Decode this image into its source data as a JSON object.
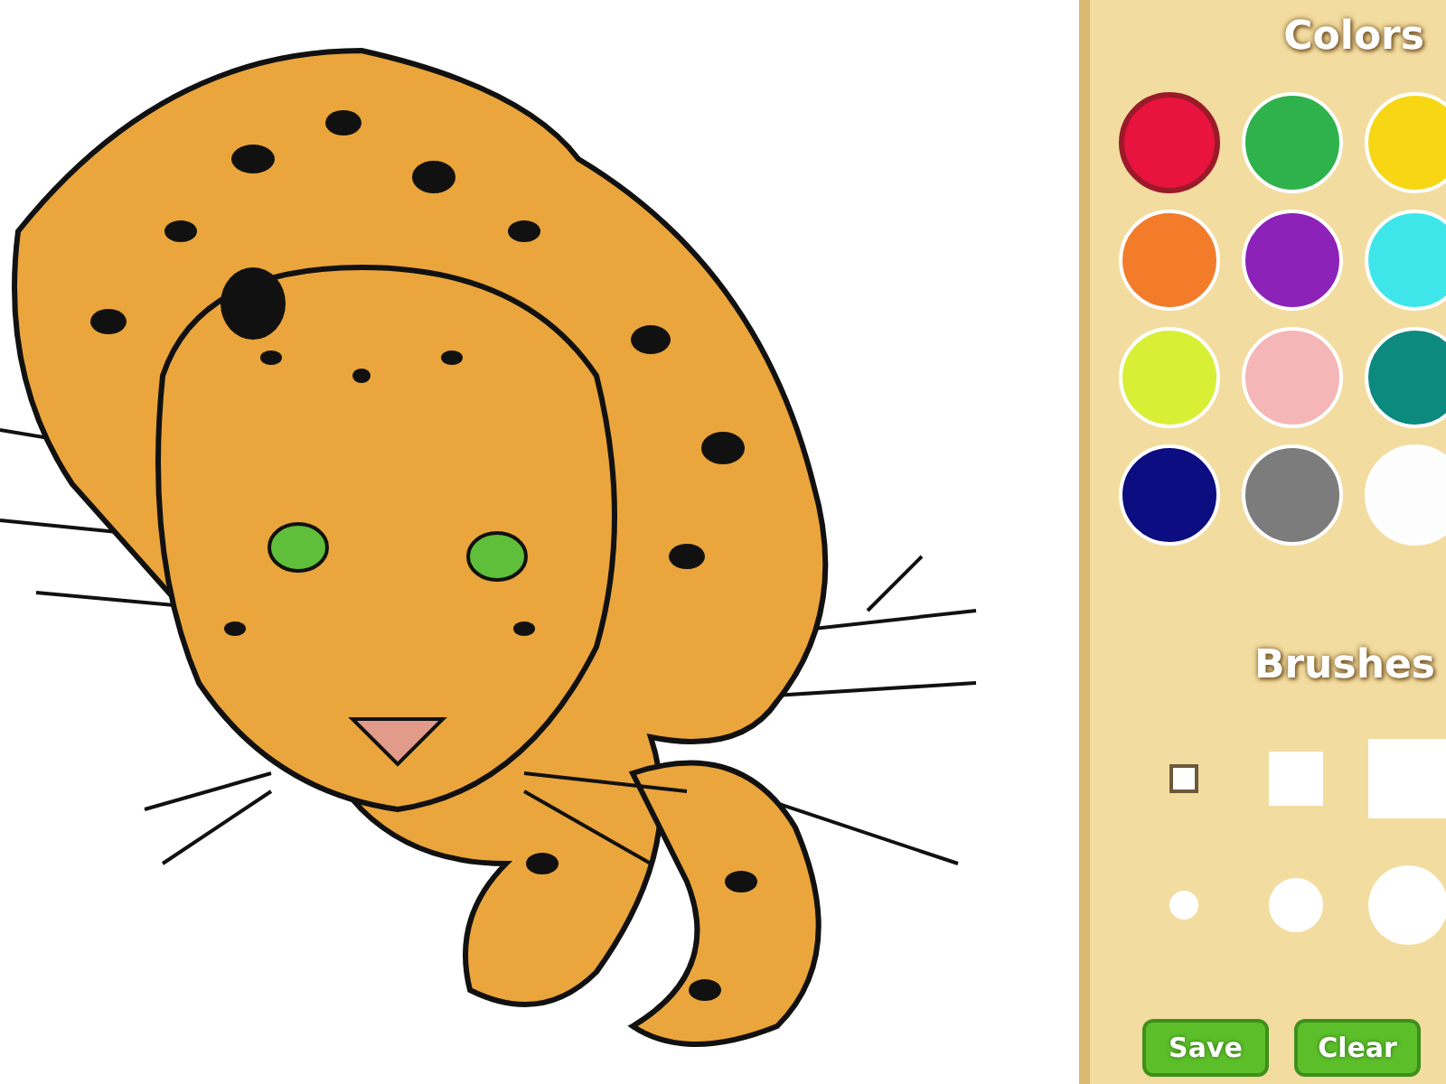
{
  "palette": {
    "title": "Colors",
    "colors": [
      {
        "color": "#e8133f",
        "selected": true
      },
      {
        "color": "#2fb24c",
        "selected": false
      },
      {
        "color": "#f7d713",
        "selected": false
      },
      {
        "color": "#f27c2a",
        "selected": false
      },
      {
        "color": "#8c22b8",
        "selected": false
      },
      {
        "color": "#3ee6ea",
        "selected": false
      },
      {
        "color": "#d8ef36",
        "selected": false
      },
      {
        "color": "#f4b6b6",
        "selected": false
      },
      {
        "color": "#0c8a7e",
        "selected": false
      },
      {
        "color": "#0b0d80",
        "selected": false
      },
      {
        "color": "#7c7c7c",
        "selected": false
      },
      {
        "color": "#fdfdfd",
        "selected": false
      }
    ]
  },
  "brushes": {
    "title": "Brushes",
    "items": [
      {
        "kind": "square",
        "selected": true
      },
      {
        "kind": "square",
        "selected": false
      },
      {
        "kind": "square",
        "selected": false
      },
      {
        "kind": "round",
        "selected": false
      },
      {
        "kind": "round",
        "selected": false
      },
      {
        "kind": "round",
        "selected": false
      }
    ]
  },
  "buttons": [
    {
      "label": "Save"
    },
    {
      "label": "Clear"
    }
  ]
}
